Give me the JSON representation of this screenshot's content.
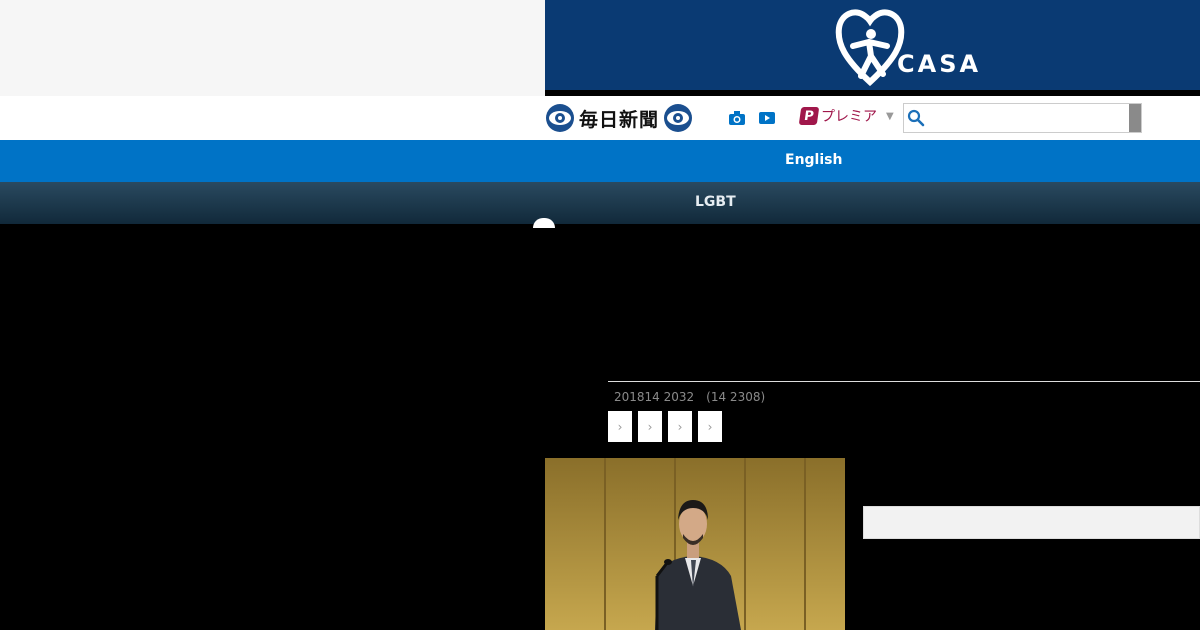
{
  "banner": {
    "brand_text": "CASA",
    "bg_color": "#0a3a73"
  },
  "header": {
    "logo_text": "毎日新聞",
    "icons": [
      "camera-icon",
      "video-play-icon"
    ],
    "premier_badge": "P",
    "premier_label": "プレミア",
    "search": {
      "placeholder": "",
      "value": ""
    }
  },
  "nav": {
    "english_label": "English",
    "english_color": "#0073c6",
    "category_label": "LGBT"
  },
  "article": {
    "dateline": "201814 2032　(14 2308)",
    "share_buttons": [
      "share-button-1",
      "share-button-2",
      "share-button-3",
      "share-button-4"
    ]
  }
}
